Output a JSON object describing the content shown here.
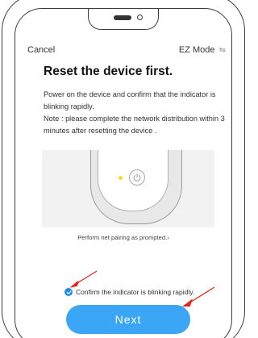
{
  "header": {
    "cancel_label": "Cancel",
    "mode_label": "EZ Mode",
    "mode_icon_glyph": "⇋"
  },
  "main": {
    "title": "Reset the device first.",
    "instruction_1": "Power on the device and confirm that the indicator is blinking rapidly.",
    "instruction_2": "Note : please complete the network distribution within 3 minutes after resetting the device ."
  },
  "pairing": {
    "link_text": "Perform net pairing as prompted.",
    "link_chevron": "›"
  },
  "confirm": {
    "label": "Confirm the indicator is blinking rapidly.",
    "checked": true
  },
  "next_button_label": "Next",
  "colors": {
    "accent": "#3ba6f5",
    "checkbox": "#1f8be8",
    "indicator_led": "#f2e01f",
    "annotation_arrow": "#e8201e"
  }
}
